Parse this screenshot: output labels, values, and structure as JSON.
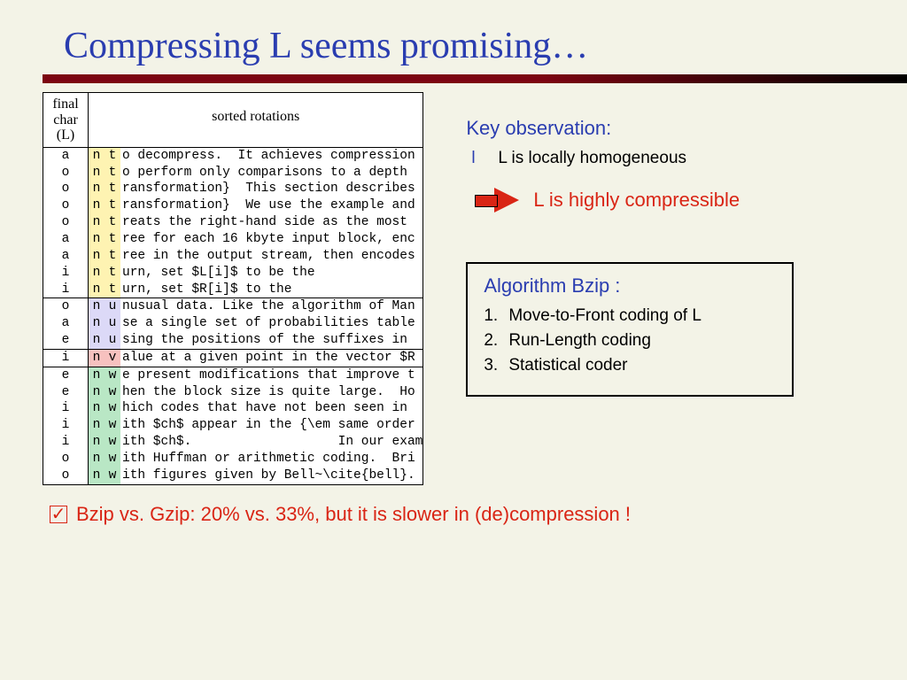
{
  "title": "Compressing L seems promising…",
  "table": {
    "header_left_l1": "final",
    "header_left_l2": "char",
    "header_left_l3": "(L)",
    "header_right": "sorted rotations",
    "rows": [
      {
        "c1": "a",
        "c2a": "n",
        "c2b": "t",
        "rest": "o decompress.  It achieves compression",
        "hl": "y"
      },
      {
        "c1": "o",
        "c2a": "n",
        "c2b": "t",
        "rest": "o perform only comparisons to a depth",
        "hl": "y"
      },
      {
        "c1": "o",
        "c2a": "n",
        "c2b": "t",
        "rest": "ransformation}  This section describes",
        "hl": "y"
      },
      {
        "c1": "o",
        "c2a": "n",
        "c2b": "t",
        "rest": "ransformation}  We use the example and",
        "hl": "y"
      },
      {
        "c1": "o",
        "c2a": "n",
        "c2b": "t",
        "rest": "reats the right-hand side as the most",
        "hl": "y"
      },
      {
        "c1": "a",
        "c2a": "n",
        "c2b": "t",
        "rest": "ree for each 16 kbyte input block, enc",
        "hl": "y"
      },
      {
        "c1": "a",
        "c2a": "n",
        "c2b": "t",
        "rest": "ree in the output stream, then encodes",
        "hl": "y"
      },
      {
        "c1": "i",
        "c2a": "n",
        "c2b": "t",
        "rest": "urn, set $L[i]$ to be the",
        "hl": "y"
      },
      {
        "c1": "i",
        "c2a": "n",
        "c2b": "t",
        "rest": "urn, set $R[i]$ to the",
        "hl": "y"
      },
      {
        "c1": "o",
        "c2a": "n",
        "c2b": "u",
        "rest": "nusual data. Like the algorithm of Man",
        "hl": "p",
        "sep": true
      },
      {
        "c1": "a",
        "c2a": "n",
        "c2b": "u",
        "rest": "se a single set of probabilities table",
        "hl": "p"
      },
      {
        "c1": "e",
        "c2a": "n",
        "c2b": "u",
        "rest": "sing the positions of the suffixes in",
        "hl": "p"
      },
      {
        "c1": "i",
        "c2a": "n",
        "c2b": "v",
        "rest": "alue at a given point in the vector $R",
        "hl": "r",
        "sep": true
      },
      {
        "c1": "e",
        "c2a": "n",
        "c2b": "w",
        "rest": "e present modifications that improve t",
        "hl": "g",
        "sep": true
      },
      {
        "c1": "e",
        "c2a": "n",
        "c2b": "w",
        "rest": "hen the block size is quite large.  Ho",
        "hl": "g"
      },
      {
        "c1": "i",
        "c2a": "n",
        "c2b": "w",
        "rest": "hich codes that have not been seen in",
        "hl": "g"
      },
      {
        "c1": "i",
        "c2a": "n",
        "c2b": "w",
        "rest": "ith $ch$ appear in the {\\em same order",
        "hl": "g"
      },
      {
        "c1": "i",
        "c2a": "n",
        "c2b": "w",
        "rest": "ith $ch$.                   In our exam",
        "hl": "g"
      },
      {
        "c1": "o",
        "c2a": "n",
        "c2b": "w",
        "rest": "ith Huffman or arithmetic coding.  Bri",
        "hl": "g"
      },
      {
        "c1": "o",
        "c2a": "n",
        "c2b": "w",
        "rest": "ith figures given by Bell~\\cite{bell}.",
        "hl": "g"
      }
    ]
  },
  "key": {
    "title": "Key observation:",
    "bullet_marker": "l",
    "bullet_text": "L is locally homogeneous",
    "arrow_text": "L is highly compressible"
  },
  "bzip": {
    "title": "Algorithm Bzip :",
    "items": [
      "Move-to-Front coding of L",
      "Run-Length coding",
      "Statistical coder"
    ]
  },
  "footer": {
    "check": "✓",
    "text": "Bzip vs. Gzip: 20% vs. 33%, but it is slower in (de)compression !"
  }
}
